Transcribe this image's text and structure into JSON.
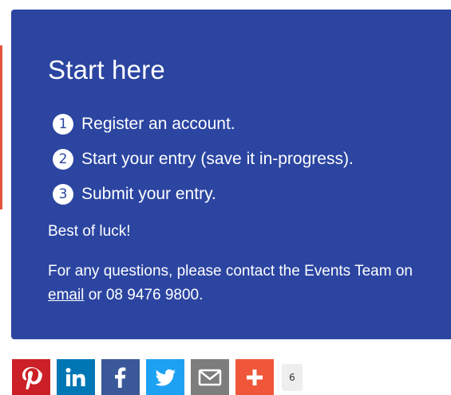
{
  "panel": {
    "title": "Start here",
    "steps": [
      {
        "number": "1",
        "text": "Register an account."
      },
      {
        "number": "2",
        "text": "Start your entry (save it in-progress)."
      },
      {
        "number": "3",
        "text": "Submit your entry."
      }
    ],
    "closing": "Best of luck!",
    "contact": {
      "prefix": "For any questions, please contact the Events Team on",
      "link_text": "email",
      "suffix": "or 08 9476 9800."
    }
  },
  "share": {
    "buttons": [
      {
        "icon": "pinterest-icon",
        "color": "#cb2027"
      },
      {
        "icon": "linkedin-icon",
        "color": "#0077b5"
      },
      {
        "icon": "facebook-icon",
        "color": "#3b5998"
      },
      {
        "icon": "twitter-icon",
        "color": "#1da1f2"
      },
      {
        "icon": "email-icon",
        "color": "#7d7d7d"
      },
      {
        "icon": "plus-icon",
        "color": "#f0563a"
      }
    ],
    "count": "6"
  },
  "colors": {
    "panel_background": "#2b45a1",
    "accent_rule": "#e0533d"
  }
}
